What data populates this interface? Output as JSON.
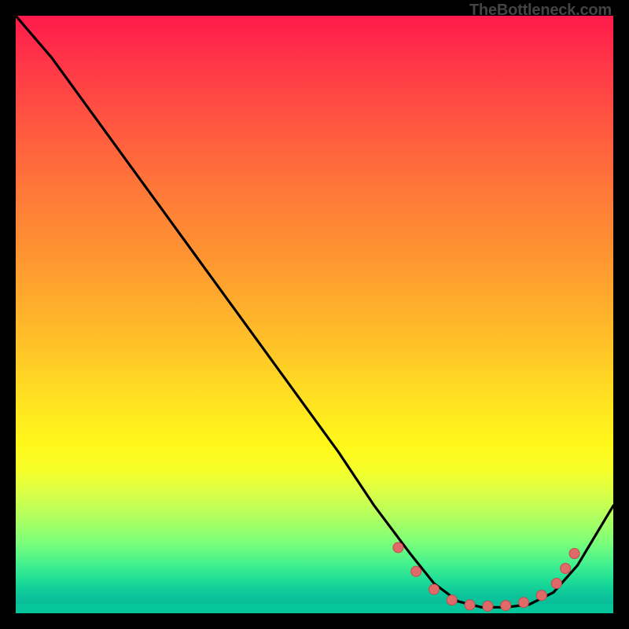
{
  "attribution": "TheBottleneck.com",
  "colors": {
    "background": "#000000",
    "curve": "#000000",
    "marker_fill": "#e06a6a",
    "marker_stroke": "#c84a4a",
    "gradient_top": "#ff1a4b",
    "gradient_bottom": "#06c59a"
  },
  "chart_data": {
    "type": "line",
    "title": "",
    "xlabel": "",
    "ylabel": "",
    "xlim": [
      0,
      100
    ],
    "ylim": [
      0,
      100
    ],
    "grid": false,
    "series": [
      {
        "name": "bottleneck-curve",
        "x": [
          0,
          6,
          14,
          22,
          30,
          38,
          46,
          54,
          60,
          66,
          70,
          74,
          78,
          82,
          86,
          90,
          94,
          100
        ],
        "y": [
          100,
          93,
          82,
          71,
          60,
          49,
          38,
          27,
          18,
          10,
          5,
          2,
          1,
          1,
          1.5,
          3.5,
          8,
          18
        ]
      }
    ],
    "markers": [
      {
        "x": 64,
        "y": 11
      },
      {
        "x": 67,
        "y": 7
      },
      {
        "x": 70,
        "y": 4
      },
      {
        "x": 73,
        "y": 2.2
      },
      {
        "x": 76,
        "y": 1.4
      },
      {
        "x": 79,
        "y": 1.2
      },
      {
        "x": 82,
        "y": 1.3
      },
      {
        "x": 85,
        "y": 1.8
      },
      {
        "x": 88,
        "y": 3
      },
      {
        "x": 90.5,
        "y": 5
      },
      {
        "x": 92,
        "y": 7.5
      },
      {
        "x": 93.5,
        "y": 10
      }
    ]
  }
}
